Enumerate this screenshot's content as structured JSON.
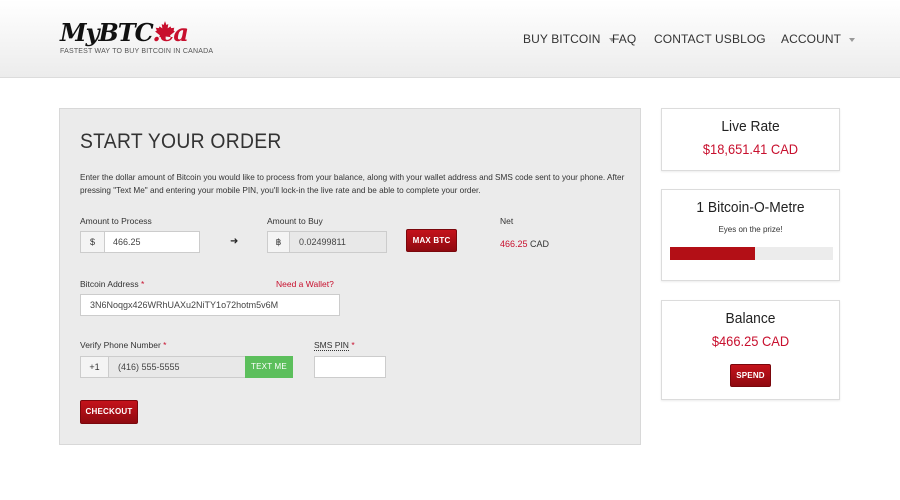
{
  "brand": {
    "name_prefix": "My",
    "name_main": "BTC",
    "name_suffix": ".ca",
    "tagline": "FASTEST WAY TO BUY BITCOIN IN CANADA",
    "accent_color": "#c8102e"
  },
  "nav": {
    "items": [
      {
        "label": "BUY BITCOIN",
        "has_dropdown": true
      },
      {
        "label": "FAQ",
        "has_dropdown": false
      },
      {
        "label": "CONTACT US",
        "has_dropdown": false
      },
      {
        "label": "BLOG",
        "has_dropdown": false
      },
      {
        "label": "ACCOUNT",
        "has_dropdown": true
      }
    ]
  },
  "order": {
    "title": "START YOUR ORDER",
    "description": "Enter the dollar amount of Bitcoin you would like to process from your balance, along with your wallet address and SMS code sent to your phone. After pressing \"Text Me\" and entering your mobile PIN, you'll lock-in the live rate and be able to complete your order.",
    "amount_process": {
      "label": "Amount to Process",
      "prefix": "$",
      "value": "466.25"
    },
    "amount_buy": {
      "label": "Amount to Buy",
      "prefix": "฿",
      "value": "0.02499811"
    },
    "max_btc_label": "MAX BTC",
    "net": {
      "label": "Net",
      "value": "466.25",
      "currency": "CAD"
    },
    "bitcoin_address": {
      "label": "Bitcoin Address",
      "required_mark": "*",
      "value": "3N6Noqgx426WRhUAXu2NiTY1o72hotm5v6M"
    },
    "need_wallet_label": "Need a Wallet?",
    "phone": {
      "label": "Verify Phone Number",
      "required_mark": "*",
      "prefix": "+1",
      "value": "(416) 555-5555"
    },
    "text_me_label": "TEXT ME",
    "sms_pin": {
      "label": "SMS PIN",
      "required_mark": "*",
      "value": ""
    },
    "checkout_label": "CHECKOUT"
  },
  "live_rate": {
    "title": "Live Rate",
    "value": "$18,651.41 CAD"
  },
  "meter": {
    "title": "1 Bitcoin-O-Metre",
    "subtitle": "Eyes on the prize!",
    "progress_fraction": 0.52
  },
  "balance": {
    "title": "Balance",
    "value": "$466.25 CAD",
    "spend_label": "SPEND"
  }
}
